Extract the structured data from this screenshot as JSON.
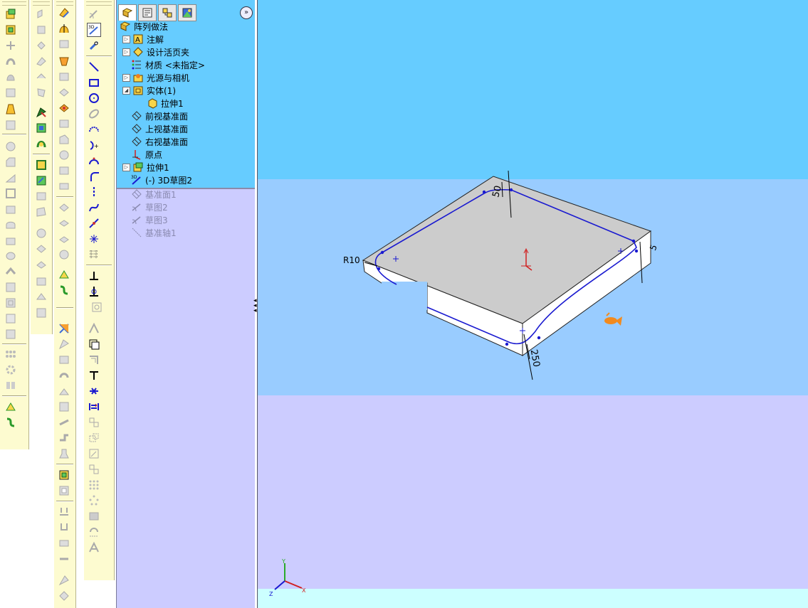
{
  "feature_tree": {
    "tabs": [
      "feature-manager",
      "property-manager",
      "configuration-manager",
      "appearance-manager"
    ],
    "root_label": "阵列做法",
    "items": [
      {
        "label": "注解",
        "icon": "annotations-icon",
        "expander": "▷"
      },
      {
        "label": "设计活页夹",
        "icon": "design-binder-icon",
        "expander": "▷"
      },
      {
        "label": "材质 <未指定>",
        "icon": "material-icon",
        "expander": ""
      },
      {
        "label": "光源与相机",
        "icon": "lights-cameras-icon",
        "expander": "▷"
      },
      {
        "label": "实体(1)",
        "icon": "solid-bodies-icon",
        "expander": "◢"
      },
      {
        "label": "拉伸1",
        "icon": "extrude-body-icon",
        "expander": ""
      },
      {
        "label": "前视基准面",
        "icon": "plane-icon",
        "expander": ""
      },
      {
        "label": "上视基准面",
        "icon": "plane-icon",
        "expander": ""
      },
      {
        "label": "右视基准面",
        "icon": "plane-icon",
        "expander": ""
      },
      {
        "label": "原点",
        "icon": "origin-icon",
        "expander": ""
      },
      {
        "label": "拉伸1",
        "icon": "extrude-feature-icon",
        "expander": "▷"
      },
      {
        "label": "(-) 3D草图2",
        "icon": "3d-sketch-icon",
        "expander": ""
      }
    ],
    "rolled_back_items": [
      {
        "label": "基准面1",
        "icon": "plane-icon"
      },
      {
        "label": "草图2",
        "icon": "sketch-icon"
      },
      {
        "label": "草图3",
        "icon": "sketch-icon"
      },
      {
        "label": "基准轴1",
        "icon": "axis-icon"
      }
    ]
  },
  "viewport": {
    "dimensions": {
      "radius": "R10",
      "dim_top": "50",
      "dim_right": "5",
      "dim_bottom": "250"
    },
    "triad": {
      "x": "X",
      "y": "Y",
      "z": "Z"
    },
    "colors": {
      "sky_top": "#66ccff",
      "sky_band": "#99ccff",
      "floor": "#ccccff",
      "floor_bottom": "#ccffff",
      "part_top": "#cccccc",
      "part_side": "#ffffff",
      "sketch_line": "#1a1ad0"
    }
  },
  "toolbars": {
    "background": "#fdfbd0"
  }
}
